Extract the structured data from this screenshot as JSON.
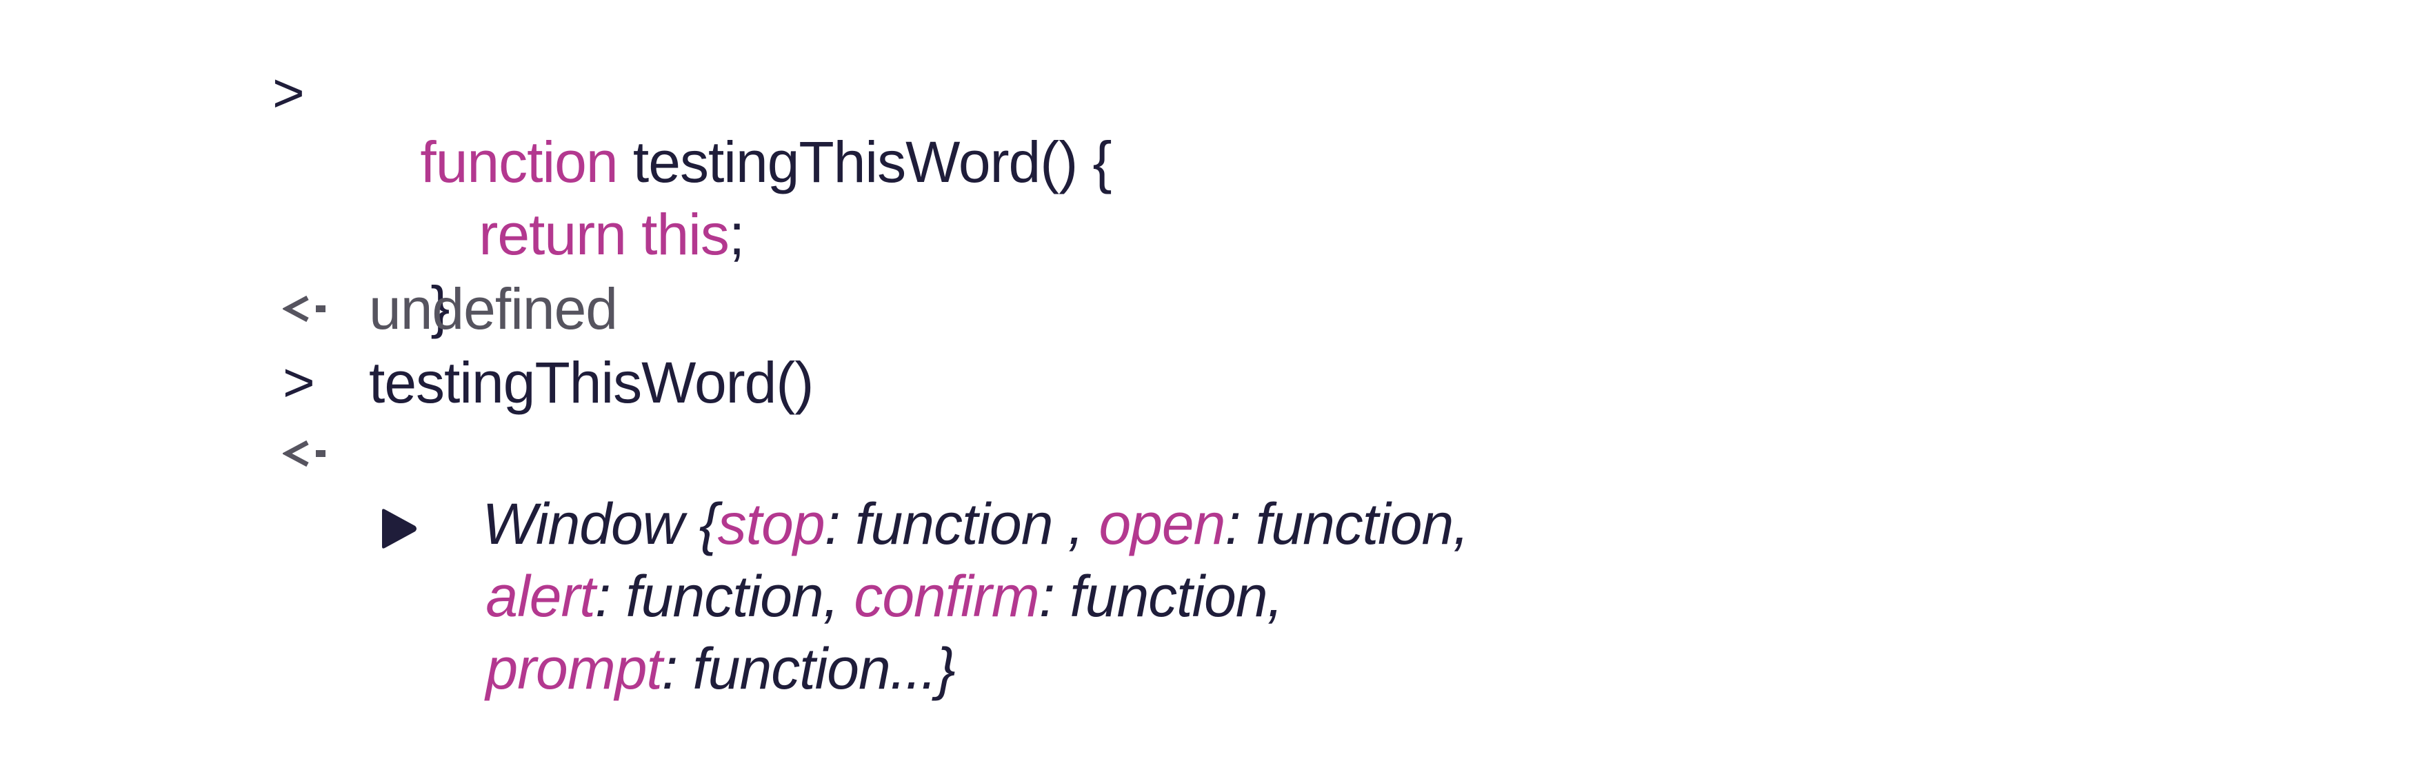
{
  "console": {
    "entries": [
      {
        "type": "input",
        "prompt": ">",
        "lines": [
          [
            {
              "t": "function",
              "k": "kw"
            },
            {
              "t": " testingThisWord() {",
              "k": "plain"
            }
          ],
          [
            {
              "t": "return this",
              "k": "kw"
            },
            {
              "t": ";",
              "k": "plain"
            }
          ],
          [
            {
              "t": "}",
              "k": "plain"
            }
          ]
        ]
      },
      {
        "type": "output",
        "arrow_icon": "return-arrow-icon",
        "text": "undefined"
      },
      {
        "type": "input",
        "prompt": ">",
        "text": "testingThisWord()"
      },
      {
        "type": "output",
        "arrow_icon": "return-arrow-icon",
        "expand_icon": "expand-triangle-icon",
        "lines": [
          [
            {
              "t": "Window {",
              "k": "plain"
            },
            {
              "t": "stop",
              "k": "prop"
            },
            {
              "t": ": function , ",
              "k": "plain"
            },
            {
              "t": "open",
              "k": "prop"
            },
            {
              "t": ": function,",
              "k": "plain"
            }
          ],
          [
            {
              "t": "alert",
              "k": "prop"
            },
            {
              "t": ": function, ",
              "k": "plain"
            },
            {
              "t": "confirm",
              "k": "prop"
            },
            {
              "t": ": function,",
              "k": "plain"
            }
          ],
          [
            {
              "t": "prompt",
              "k": "prop"
            },
            {
              "t": ": function...}",
              "k": "plain"
            }
          ]
        ]
      }
    ]
  },
  "colors": {
    "keyword": "#b3388f",
    "text": "#1f1d3a",
    "muted": "#56545f"
  }
}
